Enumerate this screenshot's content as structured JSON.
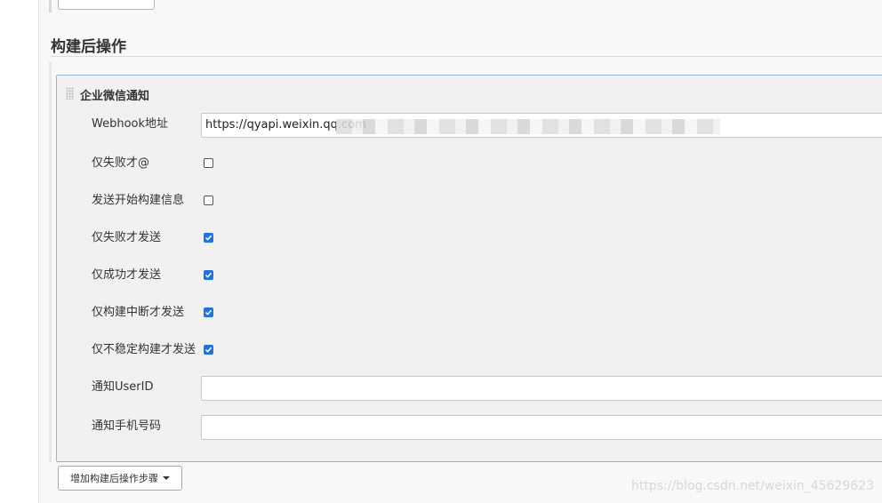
{
  "section": {
    "title": "构建后操作"
  },
  "panel": {
    "title": "企业微信通知",
    "webhook": {
      "label": "Webhook地址",
      "value": "https://qyapi.weixin.qq.com"
    },
    "checkboxes": [
      {
        "label": "仅失败才@",
        "checked": false
      },
      {
        "label": "发送开始构建信息",
        "checked": false
      },
      {
        "label": "仅失败才发送",
        "checked": true
      },
      {
        "label": "仅成功才发送",
        "checked": true
      },
      {
        "label": "仅构建中断才发送",
        "checked": true
      },
      {
        "label": "仅不稳定构建才发送",
        "checked": true
      }
    ],
    "userid": {
      "label": "通知UserID",
      "value": ""
    },
    "phone": {
      "label": "通知手机号码",
      "value": ""
    }
  },
  "add_step": {
    "label": "增加构建后操作步骤"
  },
  "watermark": "https://blog.csdn.net/weixin_45629623",
  "colors": {
    "accent": "#1a73e8",
    "panel_border": "#8fb5d8"
  }
}
